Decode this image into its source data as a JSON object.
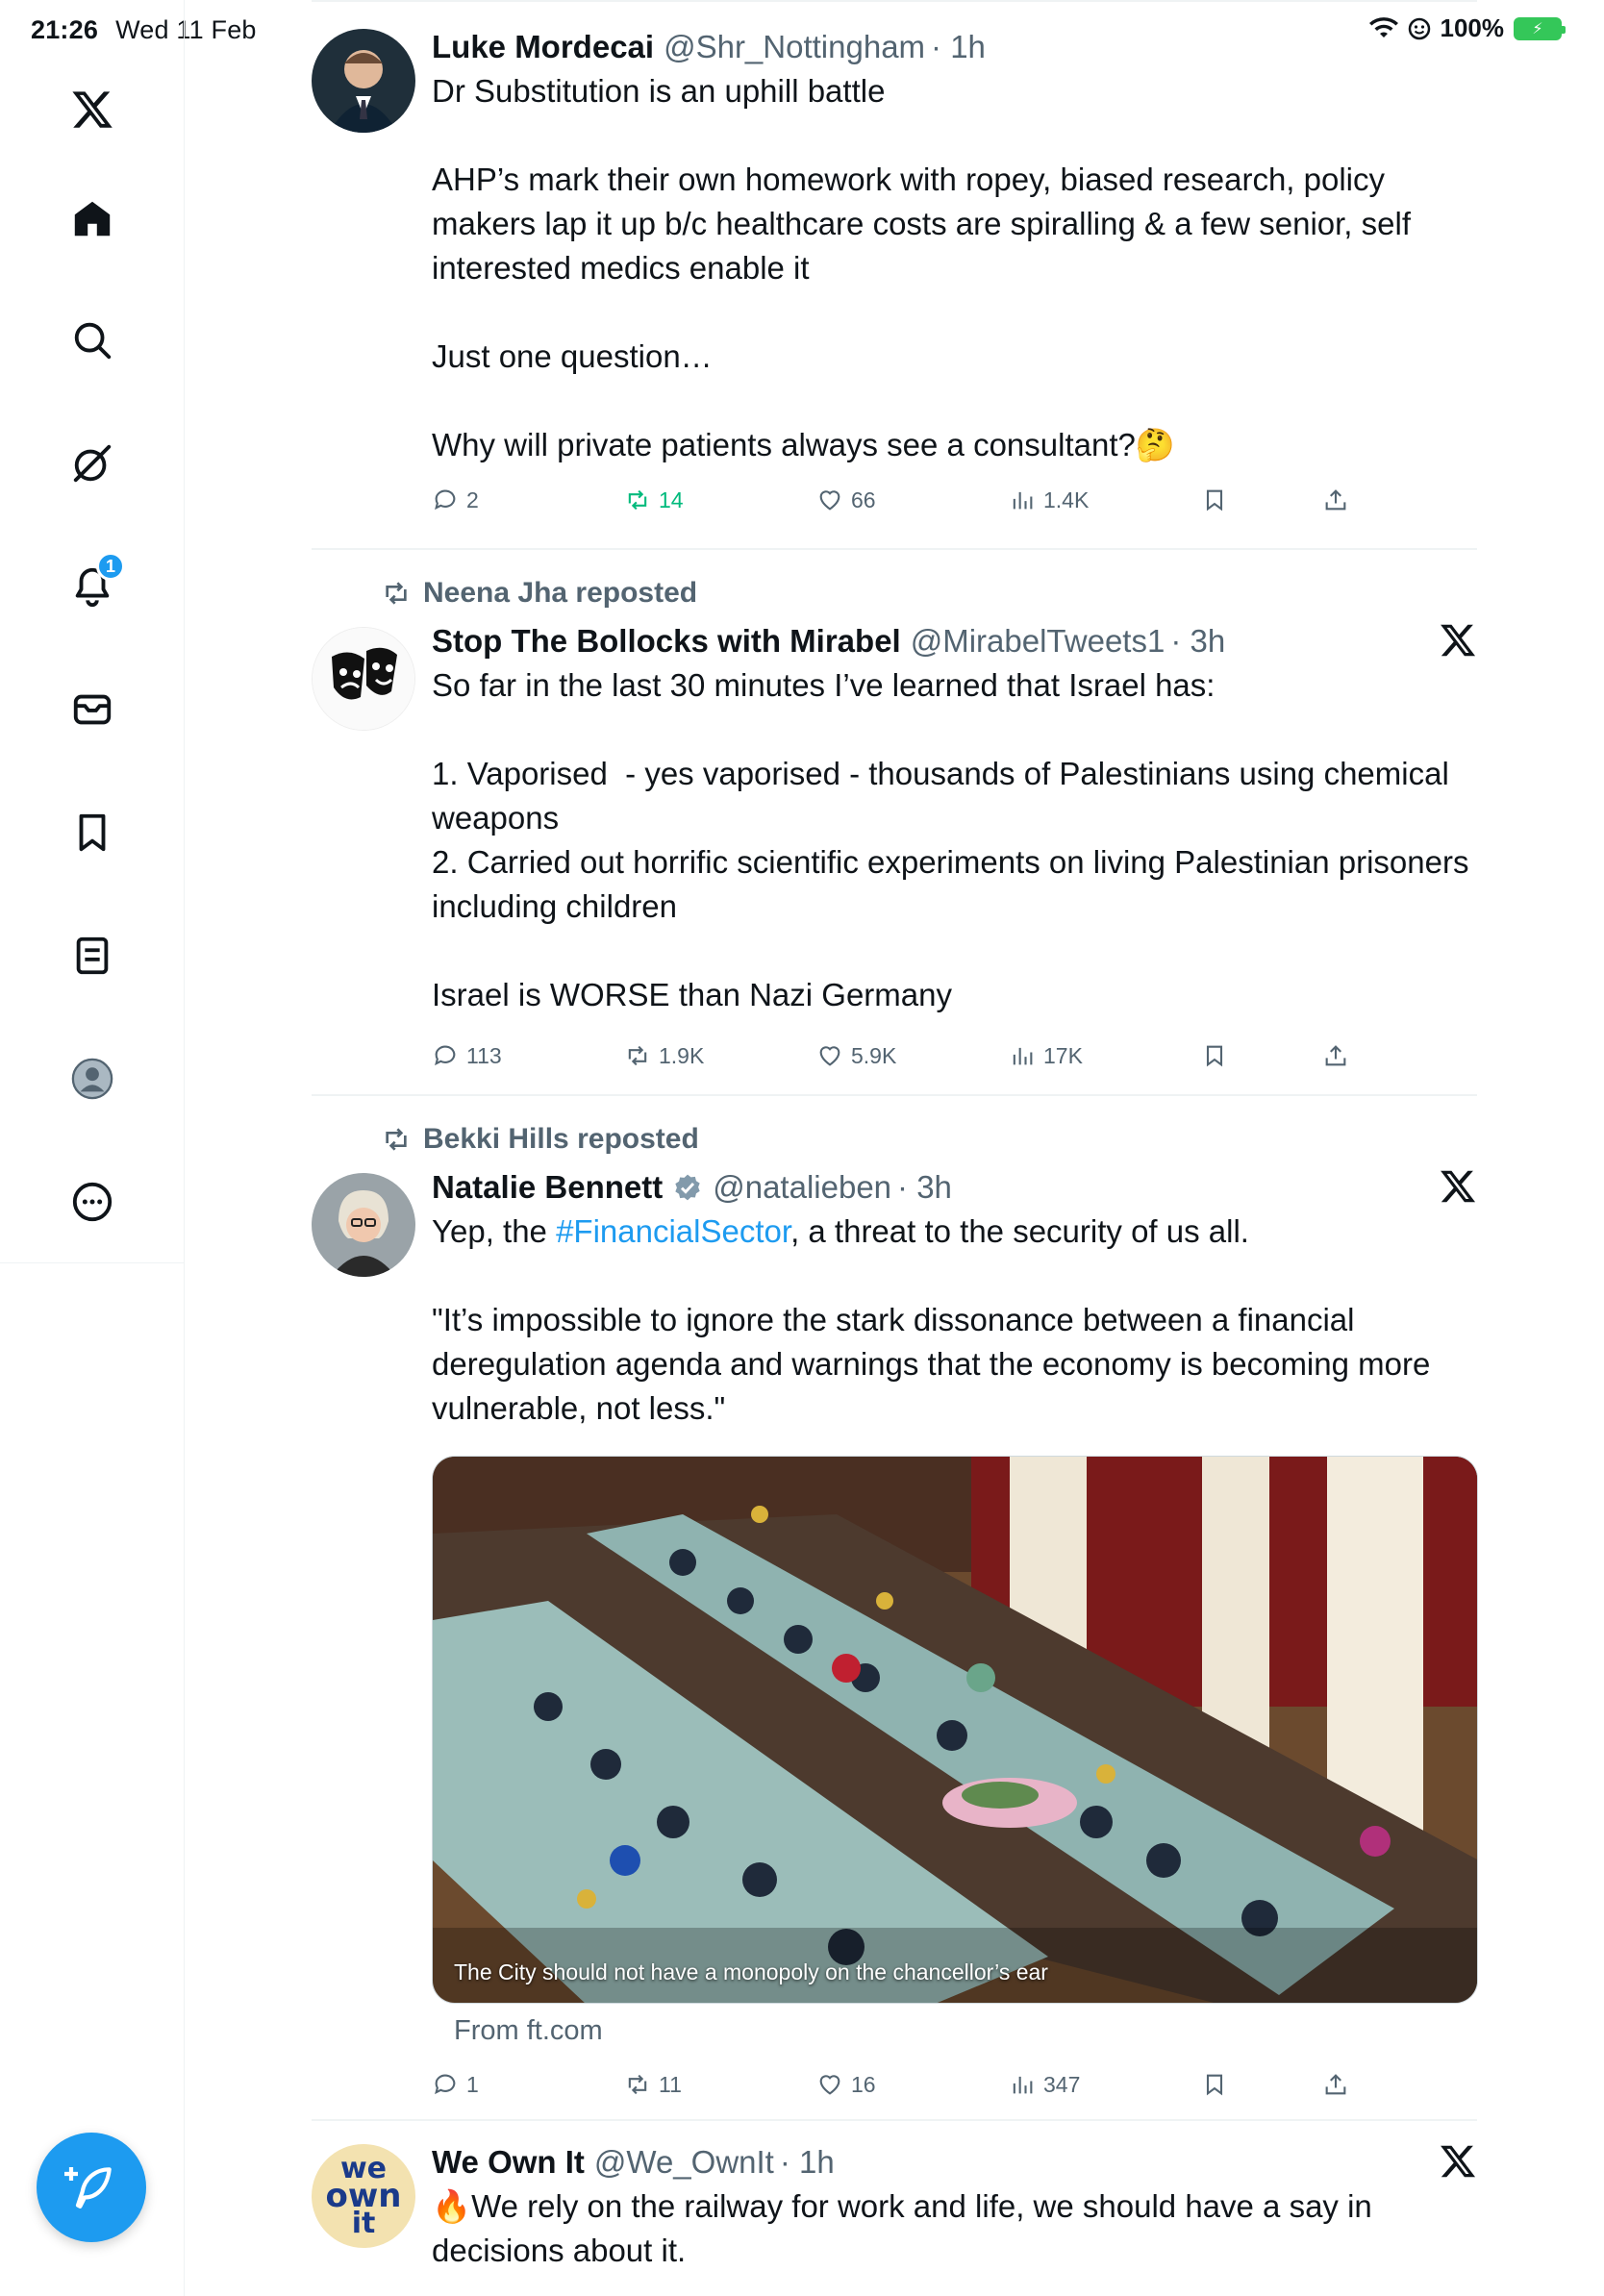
{
  "status_bar": {
    "time": "21:26",
    "date": "Wed 11 Feb",
    "battery": "100%"
  },
  "sidebar": {
    "items": [
      {
        "label": "X",
        "icon": "x-logo-icon"
      },
      {
        "label": "Home",
        "icon": "home-icon"
      },
      {
        "label": "Search",
        "icon": "search-icon"
      },
      {
        "label": "Grok",
        "icon": "grok-icon"
      },
      {
        "label": "Notifications",
        "icon": "bell-icon",
        "badge": "1"
      },
      {
        "label": "Messages",
        "icon": "mail-icon"
      },
      {
        "label": "Bookmarks",
        "icon": "bookmark-icon"
      },
      {
        "label": "Lists",
        "icon": "lists-icon"
      },
      {
        "label": "Profile",
        "icon": "profile-icon"
      },
      {
        "label": "More",
        "icon": "more-icon"
      }
    ],
    "compose_icon": "compose-icon"
  },
  "tweets": [
    {
      "name": "Luke Mordecai",
      "handle": "@Shr_Nottingham",
      "time": "· 1h",
      "text": "Dr Substitution is an uphill battle\n\nAHP’s mark their own homework with ropey, biased research, policy makers lap it up b/c healthcare costs are spiralling & a few senior, self interested medics enable it\n\nJust one question…\n\nWhy will private patients always see a consultant?🤔",
      "replies": "2",
      "reposts": "14",
      "likes": "66",
      "views": "1.4K"
    },
    {
      "repost_by": "Neena Jha reposted",
      "name": "Stop The Bollocks with Mirabel",
      "handle": "@MirabelTweets1",
      "time": "· 3h",
      "text": "So far in the last 30 minutes I’ve learned that Israel has:\n\n1. Vaporised  - yes vaporised - thousands of Palestinians using chemical weapons\n2. Carried out horrific scientific experiments on living Palestinian prisoners including children\n\nIsrael is WORSE than Nazi Germany",
      "replies": "113",
      "reposts": "1.9K",
      "likes": "5.9K",
      "views": "17K"
    },
    {
      "repost_by": "Bekki Hills reposted",
      "name": "Natalie Bennett",
      "handle": "@natalieben",
      "time": "· 3h",
      "text_before": "Yep, the ",
      "hashtag": "#FinancialSector",
      "text_after": ", a threat to the security of us all.\n\n\"It’s impossible to ignore the stark dissonance between a financial deregulation agenda and warnings that the economy is becoming more vulnerable, not less.\"",
      "media_caption": "The City should not have a monopoly on the chancellor’s ear",
      "link_source": "From ft.com",
      "replies": "1",
      "reposts": "11",
      "likes": "16",
      "views": "347"
    },
    {
      "name": "We Own It",
      "handle": "@We_OwnIt",
      "time": "· 1h",
      "avatar_text": [
        "we",
        "own",
        "it"
      ],
      "text": "🔥We rely on the railway for work and life, we should have a say in decisions about it."
    }
  ]
}
